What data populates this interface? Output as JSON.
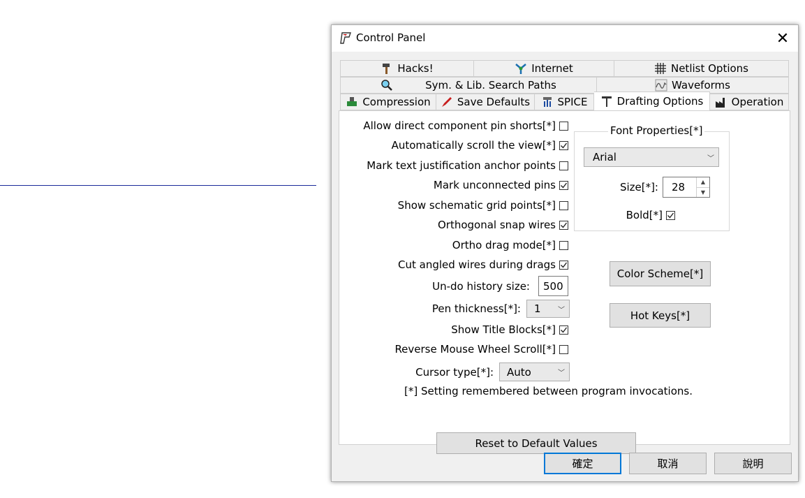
{
  "window": {
    "title": "Control Panel"
  },
  "tabs": {
    "row1": [
      "Hacks!",
      "Internet",
      "Netlist Options"
    ],
    "row2": [
      "Sym. & Lib. Search Paths",
      "Waveforms"
    ],
    "row3": [
      "Compression",
      "Save Defaults",
      "SPICE",
      "Drafting Options",
      "Operation"
    ],
    "active": "Drafting Options"
  },
  "options": [
    {
      "label": "Allow direct component pin shorts[*]",
      "checked": false
    },
    {
      "label": "Automatically scroll the view[*]",
      "checked": true
    },
    {
      "label": "Mark text justification anchor points",
      "checked": false
    },
    {
      "label": "Mark unconnected pins",
      "checked": true
    },
    {
      "label": "Show schematic grid points[*]",
      "checked": false
    },
    {
      "label": "Orthogonal snap wires",
      "checked": true
    },
    {
      "label": "Ortho drag mode[*]",
      "checked": false
    },
    {
      "label": "Cut angled wires during drags",
      "checked": true
    }
  ],
  "undo": {
    "label": "Un-do history size:",
    "value": "500"
  },
  "pen": {
    "label": "Pen thickness[*]:",
    "value": "1"
  },
  "options2": [
    {
      "label": "Show Title Blocks[*]",
      "checked": true
    },
    {
      "label": "Reverse Mouse Wheel Scroll[*]",
      "checked": false
    }
  ],
  "cursor": {
    "label": "Cursor type[*]:",
    "value": "Auto"
  },
  "note": "[*] Setting remembered between program invocations.",
  "reset_label": "Reset to Default Values",
  "font": {
    "group_label": "Font Properties[*]",
    "family": "Arial",
    "size_label": "Size[*]:",
    "size": "28",
    "bold_label": "Bold[*]",
    "bold": true
  },
  "color_scheme_label": "Color Scheme[*]",
  "hot_keys_label": "Hot Keys[*]",
  "footer": {
    "ok": "確定",
    "cancel": "取消",
    "help": "說明"
  },
  "colors": {
    "accent": "#0078d7",
    "line": "#1a2a9a"
  }
}
